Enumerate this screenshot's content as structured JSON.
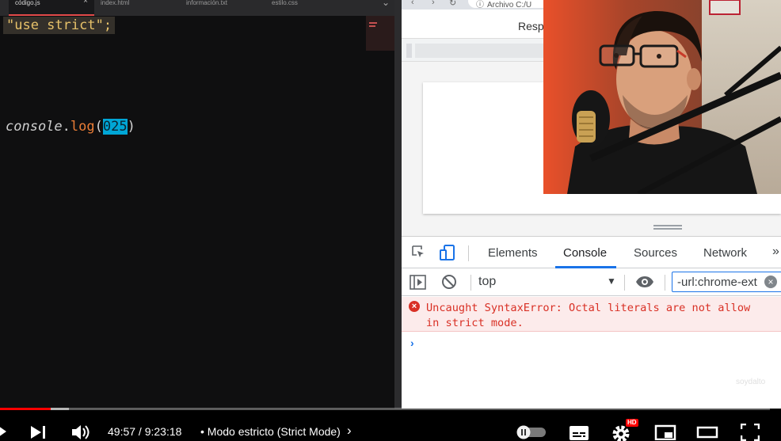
{
  "editor": {
    "tabs": [
      {
        "label": "código.js",
        "active": true
      },
      {
        "label": "index.html",
        "active": false
      },
      {
        "label": "información.txt",
        "active": false
      },
      {
        "label": "estilo.css",
        "active": false
      }
    ],
    "tab_close": "×",
    "line1": "\"use strict\";",
    "line2": {
      "object": "console",
      "dot": ".",
      "method": "log",
      "open": "(",
      "literal": "025",
      "close": ")"
    }
  },
  "browser": {
    "nav_back": "‹",
    "nav_forward": "›",
    "nav_reload": "↻",
    "address_label": "Archivo",
    "address_text": "C:/U",
    "responsive_label": "Resp",
    "devtools": {
      "tabs": [
        "Elements",
        "Console",
        "Sources",
        "Network"
      ],
      "active_tab": "Console",
      "more": "»",
      "context": "top",
      "filter_value": "-url:chrome-ext",
      "error_message": "Uncaught SyntaxError: Octal literals are not allow\nin strict mode.",
      "prompt": "›"
    },
    "watermark": "soydalto"
  },
  "player": {
    "current_time": "49:57",
    "duration": "9:23:18",
    "time_display": "49:57 / 9:23:18",
    "chapter": "• Modo estricto (Strict Mode)",
    "chapter_chevron": "›",
    "hd_badge": "HD",
    "progress_played": 0.066,
    "progress_buffered": 0.09,
    "autoplay_on": false
  },
  "colors": {
    "accent_red": "#ff0000",
    "devtools_blue": "#1a73e8",
    "error_red": "#d93025",
    "string_yellow": "#e7c26a",
    "method_orange": "#ea7d36",
    "selection_cyan": "#00a6d6"
  },
  "icons": [
    "inspect-icon",
    "device-toggle-icon",
    "sidebar-icon",
    "clear-console-icon",
    "eye-icon",
    "play-icon",
    "next-icon",
    "volume-icon",
    "autoplay-toggle",
    "subtitles-icon",
    "settings-icon",
    "miniplayer-icon",
    "theater-icon",
    "fullscreen-icon"
  ]
}
